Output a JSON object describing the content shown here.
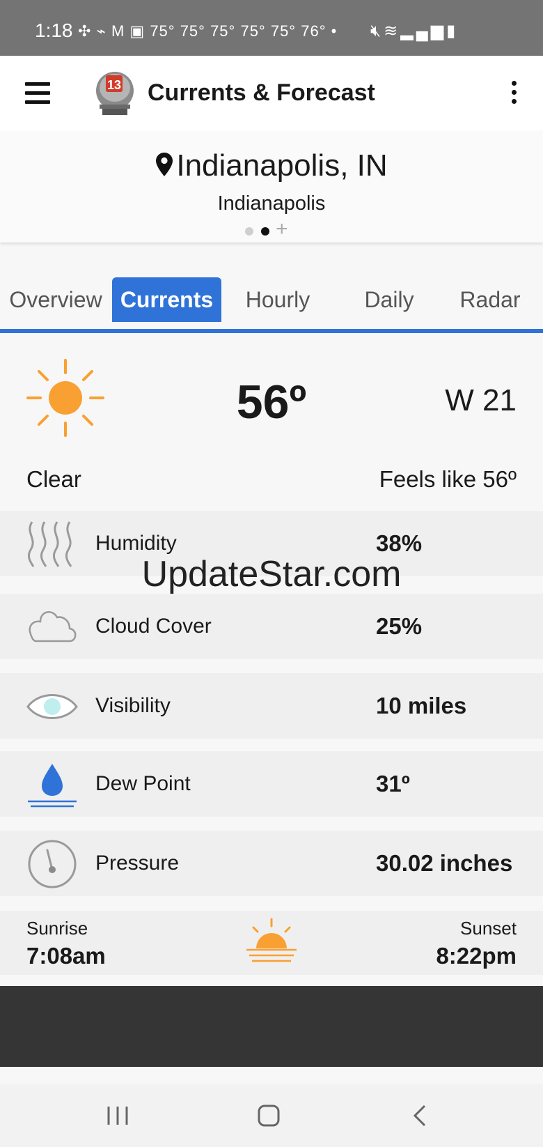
{
  "status_bar": {
    "time": "1:18",
    "notifications": "75° 75° 75° 75° 75° 76°"
  },
  "app_bar": {
    "title": "Currents & Forecast",
    "logo_text": "13"
  },
  "location": {
    "title": "Indianapolis, IN",
    "subtitle": "Indianapolis",
    "page_dots": 2,
    "active_dot": 1
  },
  "tabs": [
    {
      "label": "Overview",
      "active": false
    },
    {
      "label": "Currents",
      "active": true
    },
    {
      "label": "Hourly",
      "active": false
    },
    {
      "label": "Daily",
      "active": false
    },
    {
      "label": "Radar",
      "active": false
    }
  ],
  "current": {
    "icon": "sun-icon",
    "temperature": "56º",
    "wind": "W  21",
    "condition": "Clear",
    "feels_like": "Feels like 56º"
  },
  "details": [
    {
      "icon": "humidity-icon",
      "label": "Humidity",
      "value": "38%"
    },
    {
      "icon": "cloud-icon",
      "label": "Cloud Cover",
      "value": "25%"
    },
    {
      "icon": "eye-icon",
      "label": "Visibility",
      "value": "10 miles"
    },
    {
      "icon": "dew-drop-icon",
      "label": "Dew Point",
      "value": "31º"
    },
    {
      "icon": "gauge-icon",
      "label": "Pressure",
      "value": "30.02 inches"
    }
  ],
  "sun": {
    "sunrise_label": "Sunrise",
    "sunrise_time": "7:08am",
    "sunset_label": "Sunset",
    "sunset_time": "8:22pm"
  },
  "watermark": "UpdateStar.com",
  "colors": {
    "accent": "#2f73d8",
    "sun": "#f9a033",
    "drop": "#2f73d8"
  }
}
